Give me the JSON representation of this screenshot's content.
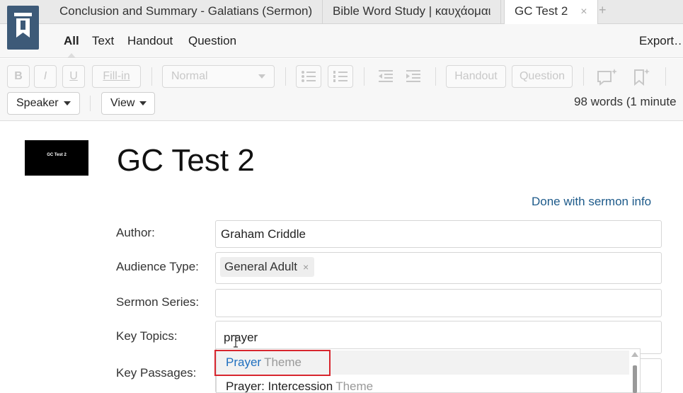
{
  "tabs": [
    {
      "label": "Conclusion and Summary - Galatians (Sermon)"
    },
    {
      "label": "Bible Word Study | καυχάομαι"
    },
    {
      "label": "GC Test 2",
      "active": true,
      "close": "×"
    }
  ],
  "new_tab_glyph": "+",
  "view_tabs": [
    "All",
    "Text",
    "Handout",
    "Question"
  ],
  "export_label": "Export…",
  "toolbar": {
    "bold": "B",
    "italic": "I",
    "underline": "U",
    "fill_in": "Fill-in",
    "style_select": "Normal",
    "handout": "Handout",
    "question": "Question",
    "speaker": "Speaker",
    "view": "View"
  },
  "word_count": "98 words (1 minute",
  "thumbnail_text": "GC Test 2",
  "title": "GC Test 2",
  "done_link": "Done with sermon info",
  "fields": {
    "author_label": "Author:",
    "author_value": "Graham Criddle",
    "audience_label": "Audience Type:",
    "audience_chip": "General Adult",
    "audience_chip_remove": "×",
    "series_label": "Sermon Series:",
    "topics_label": "Key Topics:",
    "topics_value": "prayer",
    "passages_label": "Key Passages:"
  },
  "autocomplete": [
    {
      "main": "Prayer",
      "type": "Theme"
    },
    {
      "main": "Prayer: Intercession",
      "type": "Theme"
    }
  ],
  "colors": {
    "logo_bg": "#3d5a78",
    "link": "#1d5a8a",
    "suggestion_match": "#1f6fbf",
    "highlight_outline": "#d8262e"
  },
  "icons": {
    "logo": "logos-bookmark-icon",
    "bulleted_list": "bulleted-list-icon",
    "numbered_list": "numbered-list-icon",
    "outdent": "outdent-icon",
    "indent": "indent-icon",
    "add_slide": "add-slide-icon",
    "bookmark_star": "bookmark-star-icon"
  }
}
